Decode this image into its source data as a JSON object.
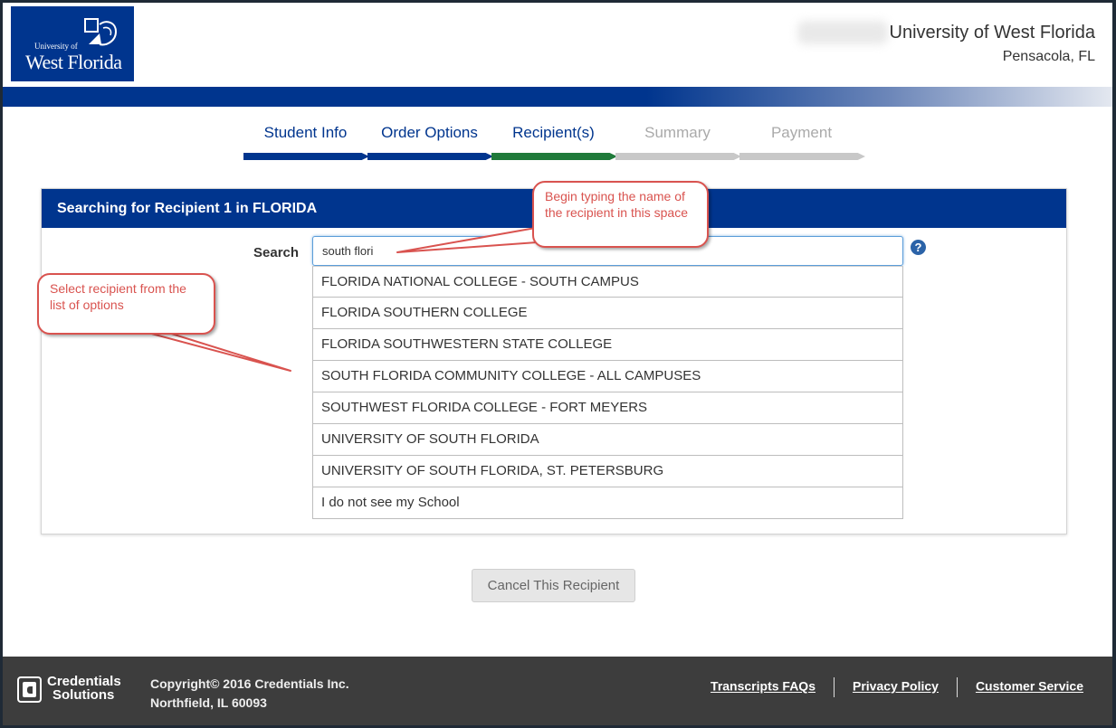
{
  "header": {
    "logo": {
      "line1": "University of",
      "line2": "West Florida"
    },
    "university_name": "University of West Florida",
    "location": "Pensacola, FL"
  },
  "steps": [
    {
      "label": "Student Info",
      "state": "done"
    },
    {
      "label": "Order Options",
      "state": "done"
    },
    {
      "label": "Recipient(s)",
      "state": "active"
    },
    {
      "label": "Summary",
      "state": "todo"
    },
    {
      "label": "Payment",
      "state": "todo"
    }
  ],
  "panel": {
    "title": "Searching for Recipient 1 in FLORIDA",
    "search_label": "Search",
    "search_value": "south flori",
    "help_icon": "question-circle-icon",
    "results": [
      "FLORIDA NATIONAL COLLEGE - SOUTH CAMPUS",
      "FLORIDA SOUTHERN COLLEGE",
      "FLORIDA SOUTHWESTERN STATE COLLEGE",
      "SOUTH FLORIDA COMMUNITY COLLEGE - ALL CAMPUSES",
      "SOUTHWEST FLORIDA COLLEGE - FORT MEYERS",
      "UNIVERSITY OF SOUTH FLORIDA",
      "UNIVERSITY OF SOUTH FLORIDA, ST. PETERSBURG",
      "I do not see my School"
    ]
  },
  "cancel_button": "Cancel This Recipient",
  "callouts": {
    "search_hint": "Begin typing the name of the recipient in this space",
    "select_hint": "Select recipient from the list of options"
  },
  "footer": {
    "brand_line1": "Credentials",
    "brand_line2": "Solutions",
    "copyright_line1": "Copyright© 2016 Credentials Inc.",
    "copyright_line2": "Northfield, IL 60093",
    "links": [
      "Transcripts FAQs",
      "Privacy Policy",
      "Customer Service"
    ]
  },
  "colors": {
    "brand_blue": "#00358e",
    "active_step_green": "#1f7a3a",
    "callout_red": "#d9534f",
    "footer_bg": "#3d3d3d"
  }
}
